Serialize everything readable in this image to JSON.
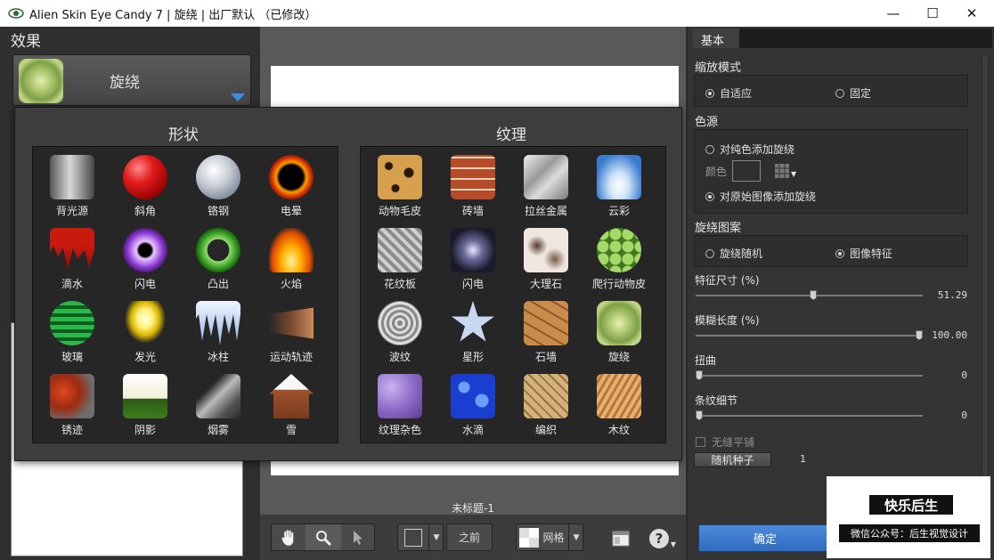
{
  "window": {
    "title": "Alien Skin Eye Candy 7 | 旋绕 | 出厂默认 （已修改）",
    "minimize": "—",
    "maximize": "☐",
    "close": "✕"
  },
  "left_panel": {
    "heading": "效果",
    "selected_effect": "旋绕"
  },
  "popup": {
    "shapes_title": "形状",
    "textures_title": "纹理",
    "shapes": [
      {
        "label": "背光源",
        "icon": "backlight-icon"
      },
      {
        "label": "斜角",
        "icon": "bevel-icon"
      },
      {
        "label": "铬钢",
        "icon": "chrome-icon"
      },
      {
        "label": "电晕",
        "icon": "corona-icon"
      },
      {
        "label": "滴水",
        "icon": "drip-icon"
      },
      {
        "label": "闪电",
        "icon": "lightning-icon"
      },
      {
        "label": "凸出",
        "icon": "extrude-icon"
      },
      {
        "label": "火焰",
        "icon": "fire-icon"
      },
      {
        "label": "玻璃",
        "icon": "glass-icon"
      },
      {
        "label": "发光",
        "icon": "glow-icon"
      },
      {
        "label": "冰柱",
        "icon": "icicles-icon"
      },
      {
        "label": "运动轨迹",
        "icon": "motion-trail-icon"
      },
      {
        "label": "锈迹",
        "icon": "rust-icon"
      },
      {
        "label": "阴影",
        "icon": "shadow-icon"
      },
      {
        "label": "烟雾",
        "icon": "smoke-icon"
      },
      {
        "label": "雪",
        "icon": "snow-icon"
      }
    ],
    "textures": [
      {
        "label": "动物毛皮",
        "icon": "animal-fur-icon"
      },
      {
        "label": "砖墙",
        "icon": "brick-wall-icon"
      },
      {
        "label": "拉丝金属",
        "icon": "brushed-metal-icon"
      },
      {
        "label": "云彩",
        "icon": "clouds-icon"
      },
      {
        "label": "花纹板",
        "icon": "diamond-plate-icon"
      },
      {
        "label": "闪电",
        "icon": "lightning-texture-icon"
      },
      {
        "label": "大理石",
        "icon": "marble-icon"
      },
      {
        "label": "爬行动物皮",
        "icon": "reptile-skin-icon"
      },
      {
        "label": "波纹",
        "icon": "ripples-icon"
      },
      {
        "label": "星形",
        "icon": "star-icon"
      },
      {
        "label": "石墙",
        "icon": "stone-wall-icon"
      },
      {
        "label": "旋绕",
        "icon": "swirl-icon"
      },
      {
        "label": "纹理杂色",
        "icon": "texture-noise-icon"
      },
      {
        "label": "水滴",
        "icon": "water-drops-icon"
      },
      {
        "label": "编织",
        "icon": "weave-icon"
      },
      {
        "label": "木纹",
        "icon": "wood-icon"
      }
    ]
  },
  "center": {
    "doc_title": "未标题-1",
    "before_label": "之前",
    "grid_label": "网格",
    "help": "?"
  },
  "right_panel": {
    "tab": "基本",
    "zoom_mode": {
      "label": "缩放模式",
      "opt_fit": "自适应",
      "opt_fixed": "固定",
      "selected": "自适应"
    },
    "color_source": {
      "label": "色源",
      "opt_solid": "对纯色添加旋绕",
      "color_label": "颜色",
      "opt_image": "对原始图像添加旋绕",
      "selected": "对原始图像添加旋绕"
    },
    "swirl_pattern": {
      "label": "旋绕图案",
      "opt_random": "旋绕随机",
      "opt_feature": "图像特征",
      "selected": "图像特征"
    },
    "sliders": [
      {
        "label": "特征尺寸 (%)",
        "value": "51.29",
        "fraction": 0.52
      },
      {
        "label": "模糊长度 (%)",
        "value": "100.00",
        "fraction": 1.0
      },
      {
        "label": "扭曲",
        "value": "0",
        "fraction": 0.0
      },
      {
        "label": "条纹细节",
        "value": "0",
        "fraction": 0.0
      }
    ],
    "seamless_tile": "无缝平铺",
    "random_seed_button": "随机种子",
    "random_seed_value": "1",
    "ok_button": "确定"
  },
  "watermark": {
    "title": "快乐后生",
    "subtitle": "微信公众号：后生视觉设计"
  }
}
